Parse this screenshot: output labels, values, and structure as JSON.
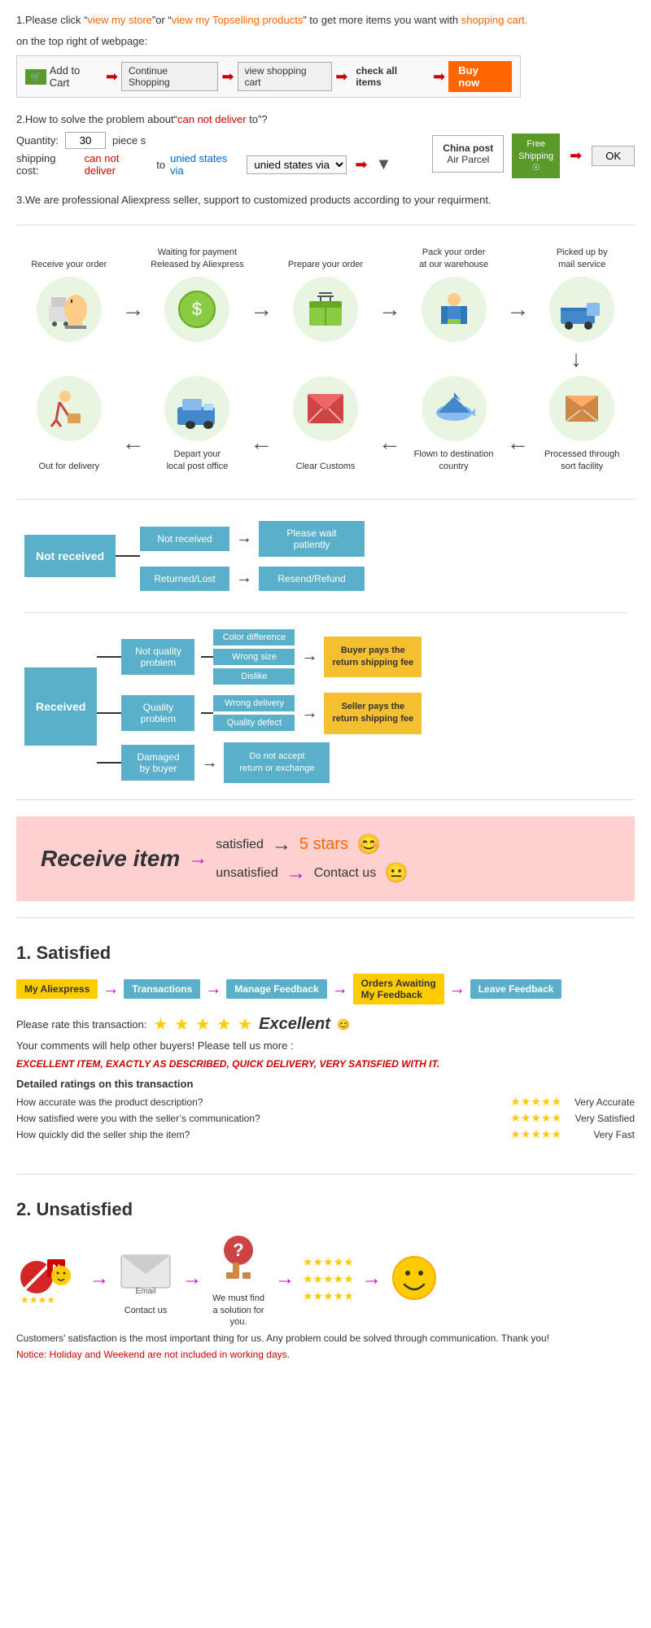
{
  "section1": {
    "text1": "1.Please click “view my store”or “view my Topselling products” to get more items you want with",
    "text1_link1": "view my store",
    "text1_link2": "view my Topselling products",
    "text1_end": "shopping cart.",
    "text2": "on the top right of webpage:",
    "cart_steps": [
      {
        "label": "🛒 Add to Cart",
        "type": "icon-btn"
      },
      {
        "label": "Continue Shopping"
      },
      {
        "label": "view shopping cart"
      },
      {
        "label": "check all items"
      },
      {
        "label": "Buy now",
        "type": "highlight"
      }
    ]
  },
  "section2": {
    "title": "2.How to solve the problem about“can not deliver to”?",
    "qty_label": "Quantity:",
    "qty_value": "30",
    "qty_unit": "piece s",
    "shipping_label": "shipping cost:",
    "shipping_text": "can not deliver",
    "shipping_to": "to",
    "shipping_via": "unied states via",
    "china_post_title": "China post",
    "china_post_sub": "Air Parcel",
    "free_shipping": "Free\nShipping",
    "ok_label": "OK"
  },
  "section3": {
    "text": "3.We are professional Aliexpress seller, support to customized products according to your requirment."
  },
  "process": {
    "top_steps": [
      {
        "label": "Receive your order",
        "icon": "💻"
      },
      {
        "label": "Waiting for payment\nReleased by Aliexpress",
        "icon": "💰"
      },
      {
        "label": "Prepare your order",
        "icon": "📦"
      },
      {
        "label": "Pack your order\nat our warehouse",
        "icon": "👷"
      },
      {
        "label": "Picked up by\nmail service",
        "icon": "🚚"
      }
    ],
    "bottom_steps": [
      {
        "label": "Out for delivery",
        "icon": "🚴"
      },
      {
        "label": "Depart your\nlocal post office",
        "icon": "🚙"
      },
      {
        "label": "Clear Customs",
        "icon": "🏷️"
      },
      {
        "label": "Flown to destination\ncountry",
        "icon": "✈️"
      },
      {
        "label": "Processed through\nsort facility",
        "icon": "📫"
      }
    ]
  },
  "flow": {
    "not_received_label": "Not received",
    "not_received_sub1": "Not received",
    "not_received_res1": "Please wait\npatiently",
    "not_received_sub2": "Returned/Lost",
    "not_received_res2": "Resend/Refund",
    "received_label": "Received",
    "nq_label": "Not quality\nproblem",
    "nq_items": [
      "Color difference",
      "Wrong size",
      "Dislike"
    ],
    "nq_result": "Buyer pays the\nreturn shipping fee",
    "q_label": "Quality\nproblem",
    "q_items": [
      "Wrong delivery",
      "Quality defect"
    ],
    "q_result": "Seller pays the\nreturn shipping fee",
    "damaged_label": "Damaged\nby buyer",
    "damaged_result": "Do not accept\nreturn or exchange"
  },
  "receive_item": {
    "title": "Receive item",
    "satisfied_label": "satisfied",
    "unsatisfied_label": "unsatisfied",
    "stars_label": "5 stars",
    "contact_label": "Contact us",
    "emoji_happy": "😊",
    "emoji_neutral": "😐"
  },
  "satisfied": {
    "title": "1. Satisfied",
    "steps": [
      "My Aliexpress",
      "Transactions",
      "Manage Feedback",
      "Orders Awaiting\nMy Feedback",
      "Leave Feedback"
    ],
    "rate_label": "Please rate this transaction:",
    "star_count": 5,
    "excellent_label": "Excellent",
    "emoji": "😊",
    "comments_label": "Your comments will help other buyers! Please tell us more :",
    "review_text": "EXCELLENT ITEM, EXACTLY AS DESCRIBED, QUICK DELIVERY, VERY SATISFIED WITH IT.",
    "ratings_title": "Detailed ratings on this transaction",
    "rating_rows": [
      {
        "label": "How accurate was the product description?",
        "stars": 5,
        "result": "Very Accurate"
      },
      {
        "label": "How satisfied were you with the seller’s communication?",
        "stars": 5,
        "result": "Very Satisfied"
      },
      {
        "label": "How quickly did the seller ship the item?",
        "stars": 5,
        "result": "Very Fast"
      }
    ]
  },
  "unsatisfied": {
    "title": "2. Unsatisfied",
    "steps": [
      {
        "label": "",
        "icon": "🚫⭐😡\n⭐⭐⭐⭐",
        "type": "no-icon"
      },
      {
        "label": "Contact us",
        "icon": "📧"
      },
      {
        "label": "We must find\na solution for\nyou.",
        "icon": "❓"
      },
      {
        "label": "",
        "icon": "⭐⭐⭐⭐⭐\n⭐⭐⭐⭐⭐\n⭐⭐⭐⭐⭐",
        "type": "stars-col"
      },
      {
        "label": "",
        "icon": "😊",
        "type": "emoji"
      }
    ],
    "notice_text": "Customers' satisfaction is the most important thing for us. Any problem could be solved through\ncommunication. Thank you!",
    "notice_red": "Notice: Holiday and Weekend are not included in working days."
  }
}
